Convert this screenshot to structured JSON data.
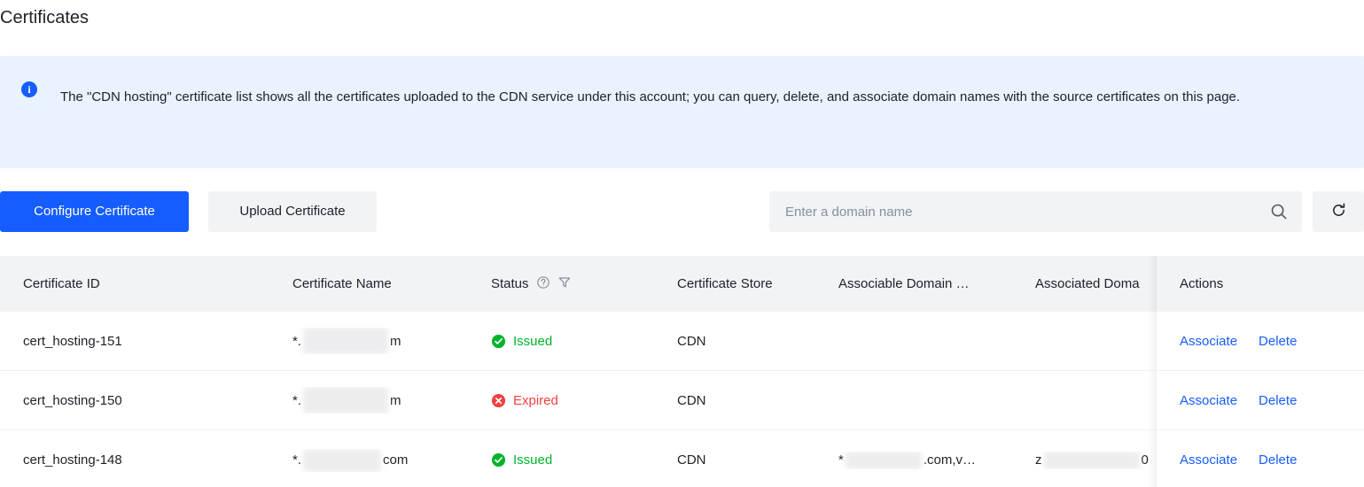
{
  "page": {
    "title": "Certificates"
  },
  "info_banner": {
    "icon": "info-circle-icon",
    "text": "The \"CDN hosting\" certificate list shows all the certificates uploaded to the CDN service under this account; you can query, delete, and associate domain names with the source certificates on this page."
  },
  "toolbar": {
    "configure_label": "Configure Certificate",
    "upload_label": "Upload Certificate",
    "search_placeholder": "Enter a domain name",
    "search_value": "",
    "search_icon": "search-icon",
    "refresh_icon": "refresh-icon"
  },
  "table": {
    "columns": [
      {
        "key": "certificate_id",
        "label": "Certificate ID"
      },
      {
        "key": "certificate_name",
        "label": "Certificate Name"
      },
      {
        "key": "status",
        "label": "Status",
        "help_icon": "question-circle-icon",
        "filter_icon": "filter-funnel-icon"
      },
      {
        "key": "certificate_store",
        "label": "Certificate Store"
      },
      {
        "key": "associable_domain",
        "label": "Associable Domain …"
      },
      {
        "key": "associated_domain",
        "label": "Associated Doma"
      },
      {
        "key": "actions",
        "label": "Actions"
      }
    ],
    "rows": [
      {
        "certificate_id": "cert_hosting-151",
        "certificate_name_prefix": "*.",
        "certificate_name_suffix": "m",
        "status": "Issued",
        "status_type": "issued",
        "certificate_store": "CDN",
        "associable_domain_prefix": "",
        "associable_domain_suffix": "",
        "associated_domain_prefix": "",
        "associated_domain_suffix": "",
        "action_associate": "Associate",
        "action_delete": "Delete"
      },
      {
        "certificate_id": "cert_hosting-150",
        "certificate_name_prefix": "*.",
        "certificate_name_suffix": "m",
        "status": "Expired",
        "status_type": "expired",
        "certificate_store": "CDN",
        "associable_domain_prefix": "",
        "associable_domain_suffix": "",
        "associated_domain_prefix": "",
        "associated_domain_suffix": "",
        "action_associate": "Associate",
        "action_delete": "Delete"
      },
      {
        "certificate_id": "cert_hosting-148",
        "certificate_name_prefix": "*.",
        "certificate_name_suffix": "com",
        "status": "Issued",
        "status_type": "issued",
        "certificate_store": "CDN",
        "associable_domain_prefix": "*",
        "associable_domain_suffix": ".com,v…",
        "associated_domain_prefix": "z",
        "associated_domain_suffix": "0",
        "action_associate": "Associate",
        "action_delete": "Delete"
      }
    ]
  },
  "colors": {
    "accent": "#165dff",
    "banner_bg": "#e8f3ff",
    "header_bg": "#f2f3f5",
    "success": "#00b42a",
    "error": "#f53f3f",
    "text": "#1d2129",
    "placeholder": "#86909c"
  }
}
